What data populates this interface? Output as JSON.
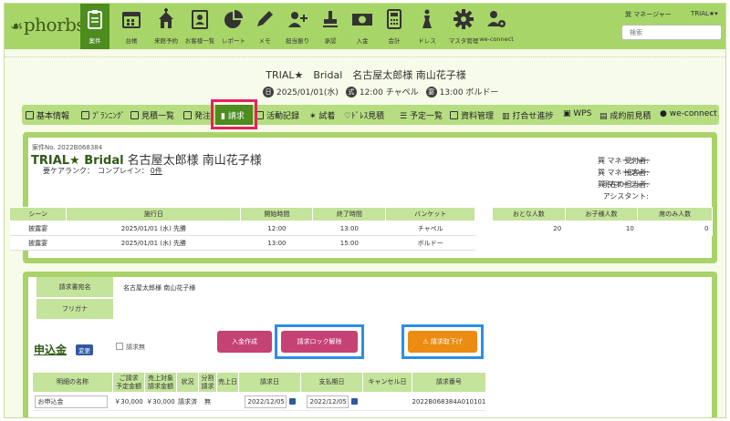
{
  "app": {
    "logo": "phorbs"
  },
  "nav": [
    {
      "label": "案件",
      "icon": "clipboard-icon",
      "active": true
    },
    {
      "label": "台帳",
      "icon": "calendar-icon"
    },
    {
      "label": "来館予約",
      "icon": "chapel-icon"
    },
    {
      "label": "お客様一覧",
      "icon": "address-book-icon"
    },
    {
      "label": "レポート",
      "icon": "pie-chart-icon"
    },
    {
      "label": "メモ",
      "icon": "pencil-icon"
    },
    {
      "label": "担当振り",
      "icon": "add-user-icon"
    },
    {
      "label": "承認",
      "icon": "stamp-icon"
    },
    {
      "label": "入金",
      "icon": "money-icon"
    },
    {
      "label": "会計",
      "icon": "calculator-icon"
    },
    {
      "label": "ドレス",
      "icon": "dress-icon"
    },
    {
      "label": "マスタ管理",
      "icon": "gear-icon"
    },
    {
      "label": "we-connect",
      "icon": "user-gear-icon"
    }
  ],
  "user": {
    "name": "巽 マネージャー",
    "tenant": "TRIAL★▾"
  },
  "search": {
    "placeholder": "検索"
  },
  "header": {
    "title": "TRIAL★　Bridal　名古屋太郎様 南山花子様",
    "date_badge": "日",
    "date": "2025/01/01(水)",
    "ceremony_badge": "式",
    "ceremony": "12:00 チャペル",
    "banquet_badge": "宴",
    "banquet": "13:00 ボルドー"
  },
  "tabs": [
    "基本情報",
    "ﾌﾟﾗﾝﾆﾝｸﾞ",
    "見積一覧",
    "発注",
    "請求",
    "活動記録",
    "試着",
    "ﾄﾞﾚｽ見積",
    "予定一覧",
    "資料管理",
    "打合せ進捗",
    "WPS",
    "成約前見積",
    "we-connect"
  ],
  "case": {
    "no": "案件No. 2022B068384",
    "brand": "TRIAL★ Bridal",
    "names": "名古屋太郎様 南山花子様",
    "rank_label": "要ケアランク：　コンプレイン：",
    "rank_count": "0件",
    "staff": [
      {
        "label": "受付者:",
        "value": "巽 マネージャー"
      },
      {
        "label": "接客者:",
        "value": "巽 マネージャー"
      },
      {
        "label": "現在の担当者:",
        "value": "巽 マネージャー"
      },
      {
        "label": "アシスタント:",
        "value": ""
      }
    ]
  },
  "schedule": {
    "headers": [
      "シーン",
      "施行日",
      "開始時間",
      "終了時間",
      "バンケット"
    ],
    "rows": [
      [
        "披露宴",
        "2025/01/01 (水) 先勝",
        "12:00",
        "13:00",
        "チャペル"
      ],
      [
        "披露宴",
        "2025/01/01 (水) 先勝",
        "13:00",
        "15:00",
        "ボルドー"
      ]
    ]
  },
  "people": {
    "headers": [
      "おとな人数",
      "お子様人数",
      "席のみ人数"
    ],
    "values": [
      "20",
      "10",
      "0"
    ]
  },
  "billing": {
    "name_label": "請求書宛名",
    "name_value": "名古屋太郎様 南山花子様",
    "kana_label": "フリガナ",
    "kana_value": "",
    "section_title": "申込金",
    "change_badge": "変更",
    "no_bill_label": "請求無",
    "btn_payment": "入金作成",
    "btn_unlock": "請求ロック解除",
    "btn_withdraw": "⚠ 請求取下げ",
    "table_headers": [
      "明細の名称",
      "ご請求\n予定金額",
      "売上対象\n請求金額",
      "状況",
      "分割\n請求",
      "売上日",
      "請求日",
      "支払期日",
      "キャンセル日",
      "請求番号"
    ],
    "row": {
      "name": "お申込金",
      "planned": "￥30,000",
      "sales": "￥30,000",
      "status": "請求済",
      "split": "無",
      "sales_date": "",
      "bill_date": "2022/12/05",
      "due_date": "2022/12/05",
      "cancel_date": "",
      "bill_no": "2022B068384A010101"
    }
  },
  "colors": {
    "nav_bg": "#a8d568",
    "nav_active": "#4d8c1f",
    "header_green": "#c4e39b",
    "highlight_red": "#e5225c",
    "highlight_blue": "#2b8ee8"
  }
}
